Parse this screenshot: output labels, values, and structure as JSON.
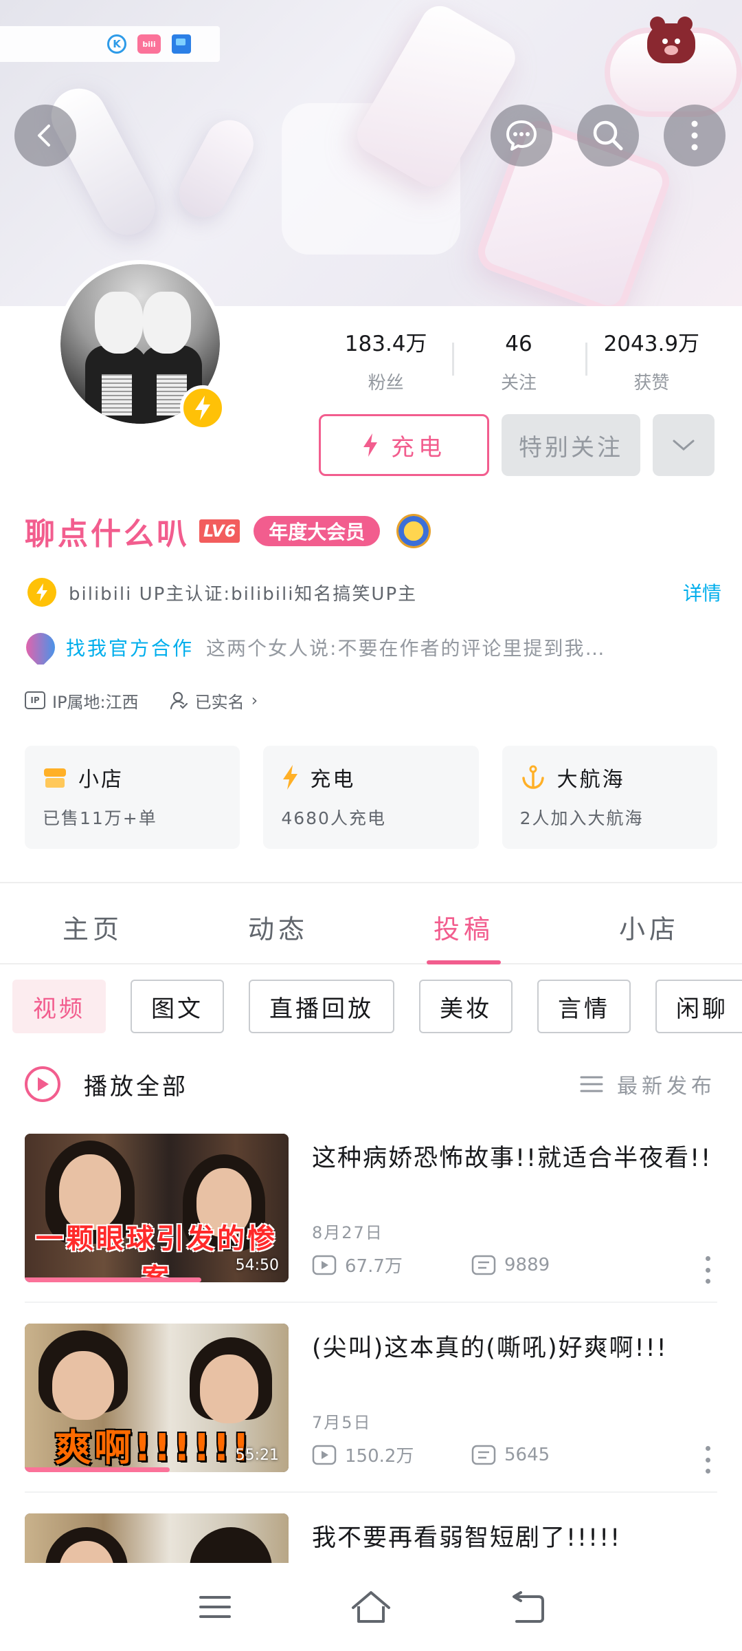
{
  "status_icons": {
    "k_icon": "K",
    "bili_icon": "bili"
  },
  "header": {
    "back_icon": "chevron-left-icon",
    "message_icon": "chat-bubble-icon",
    "search_icon": "search-icon",
    "more_icon": "more-vertical-icon"
  },
  "profile": {
    "stats": [
      {
        "value": "183.4万",
        "label": "粉丝"
      },
      {
        "value": "46",
        "label": "关注"
      },
      {
        "value": "2043.9万",
        "label": "获赞"
      }
    ],
    "charge_button": "充电",
    "follow_button": "特别关注",
    "username": "聊点什么叭",
    "level": "LV6",
    "vip_badge": "年度大会员",
    "verify_text": "bilibili UP主认证:bilibili知名搞笑UP主",
    "verify_detail": "详情",
    "coop_link": "找我官方合作",
    "coop_desc": "这两个女人说:不要在作者的评论里提到我…",
    "ip_icon": "IP",
    "ip_location": "IP属地:江西",
    "realname": "已实名",
    "realname_arrow": "›"
  },
  "cards": [
    {
      "title": "小店",
      "sub": "已售11万+单",
      "icon": "shop-icon",
      "color": "#ffb027"
    },
    {
      "title": "充电",
      "sub": "4680人充电",
      "icon": "lightning-icon",
      "color": "#ffb027"
    },
    {
      "title": "大航海",
      "sub": "2人加入大航海",
      "icon": "anchor-icon",
      "color": "#ffb027"
    }
  ],
  "tabs": [
    "主页",
    "动态",
    "投稿",
    "小店"
  ],
  "active_tab": "投稿",
  "chips": [
    "视频",
    "图文",
    "直播回放",
    "美妆",
    "言情",
    "闲聊"
  ],
  "play_all": "播放全部",
  "sort_label": "最新发布",
  "videos": [
    {
      "title": "这种病娇恐怖故事!!就适合半夜看!!",
      "date": "8月27日",
      "views": "67.7万",
      "comments": "9889",
      "duration": "54:50",
      "thumb_caption": "一颗眼球引发的惨案",
      "progress": 0.67
    },
    {
      "title": "(尖叫)这本真的(嘶吼)好爽啊!!!",
      "date": "7月5日",
      "views": "150.2万",
      "comments": "5645",
      "duration": "55:21",
      "thumb_caption": "爽啊!!!!!!",
      "progress": 0.55
    },
    {
      "title": "我不要再看弱智短剧了!!!!!"
    }
  ],
  "nav": {
    "menu_icon": "menu-icon",
    "home_icon": "home-icon",
    "back_icon": "back-icon"
  },
  "colors": {
    "accent": "#f25d8e",
    "link": "#00aeec",
    "charge": "#ffc107"
  }
}
